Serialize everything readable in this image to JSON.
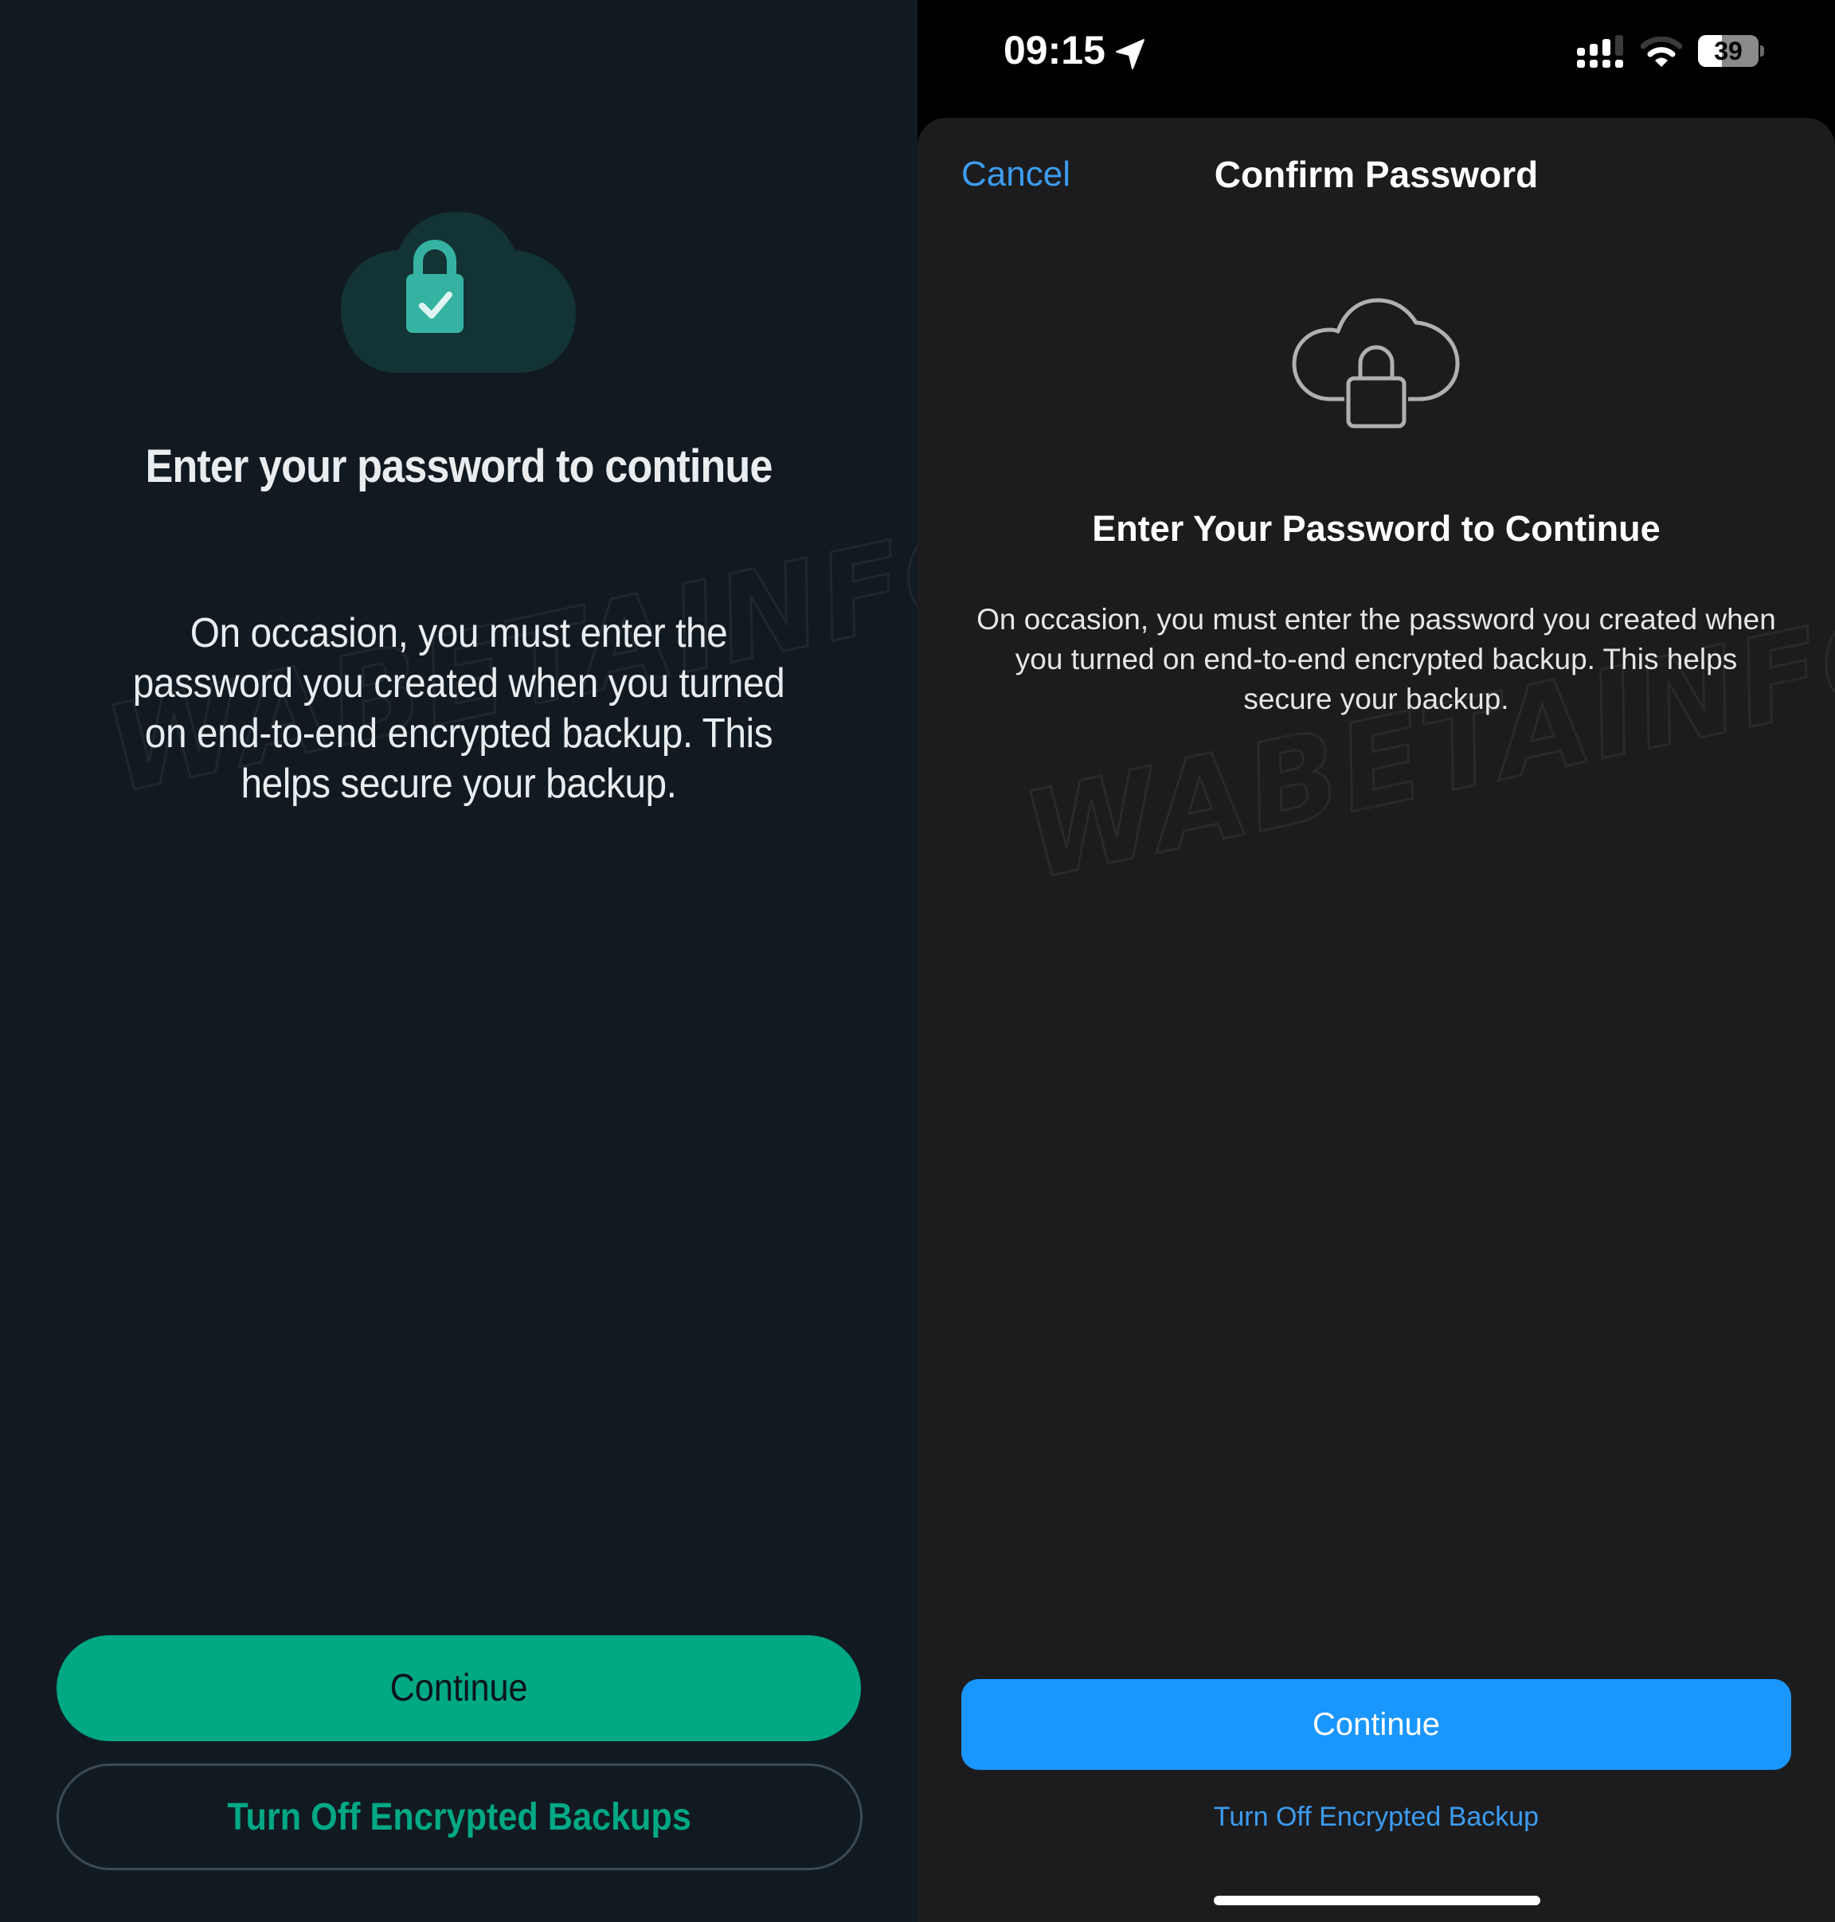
{
  "android": {
    "watermark": "WABETAINFO",
    "icon": "cloud-lock-check-icon",
    "heading": "Enter your password to continue",
    "body": "On occasion, you must enter the password you created when you turned on end-to-end encrypted backup. This helps secure your backup.",
    "continue_label": "Continue",
    "turn_off_label": "Turn Off Encrypted Backups",
    "colors": {
      "background": "#121a21",
      "accent": "#00a884",
      "cloud": "#133435",
      "lock": "#35b2a2"
    }
  },
  "ios": {
    "status_bar": {
      "time": "09:15",
      "location_icon": "location-arrow-icon",
      "signal_icon": "cellular-signal-icon",
      "wifi_icon": "wifi-icon",
      "battery_percent": "39",
      "battery_level": 0.39
    },
    "watermark": "WABETAINFO",
    "nav": {
      "cancel_label": "Cancel",
      "title": "Confirm Password"
    },
    "icon": "cloud-lock-icon",
    "heading": "Enter Your Password to Continue",
    "body": "On occasion, you must enter the password you created when you turned on end-to-end encrypted backup. This helps secure your backup.",
    "continue_label": "Continue",
    "turn_off_label": "Turn Off Encrypted Backup",
    "colors": {
      "sheet": "#1c1c1e",
      "accent": "#1a96ff",
      "link": "#3c9cf0"
    }
  }
}
